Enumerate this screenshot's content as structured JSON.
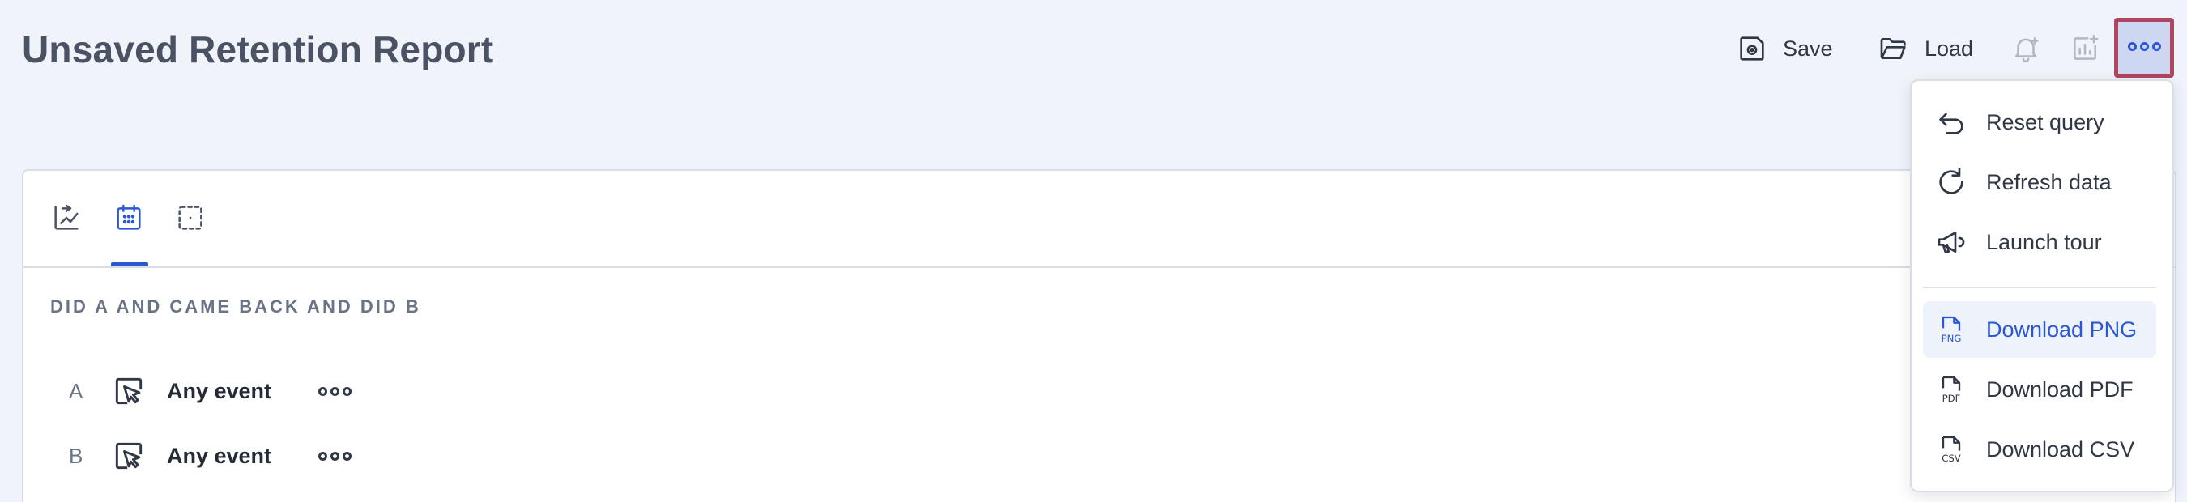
{
  "header": {
    "title": "Unsaved Retention Report"
  },
  "toolbar": {
    "save_label": "Save",
    "load_label": "Load",
    "icons": [
      "save-icon",
      "folder-icon",
      "bell-plus-icon",
      "add-to-board-icon",
      "more-horizontal-icon"
    ]
  },
  "panel": {
    "tabs": [
      "retention-tab",
      "calendar-tab",
      "selection-tab"
    ],
    "active_tab": 1,
    "section_label": "DID A AND CAME BACK AND DID B",
    "rows": [
      {
        "letter": "A",
        "label": "Any event"
      },
      {
        "letter": "B",
        "label": "Any event"
      }
    ]
  },
  "menu": {
    "items": [
      {
        "label": "Reset query",
        "icon": "undo-icon"
      },
      {
        "label": "Refresh data",
        "icon": "refresh-icon"
      },
      {
        "label": "Launch tour",
        "icon": "megaphone-icon"
      },
      {
        "label": "Download PNG",
        "icon": "png-file-icon",
        "active": true
      },
      {
        "label": "Download PDF",
        "icon": "pdf-file-icon"
      },
      {
        "label": "Download CSV",
        "icon": "csv-file-icon"
      }
    ]
  },
  "colors": {
    "accent": "#2b57d1",
    "background": "#f0f3f9",
    "highlight_border": "#b04560"
  }
}
